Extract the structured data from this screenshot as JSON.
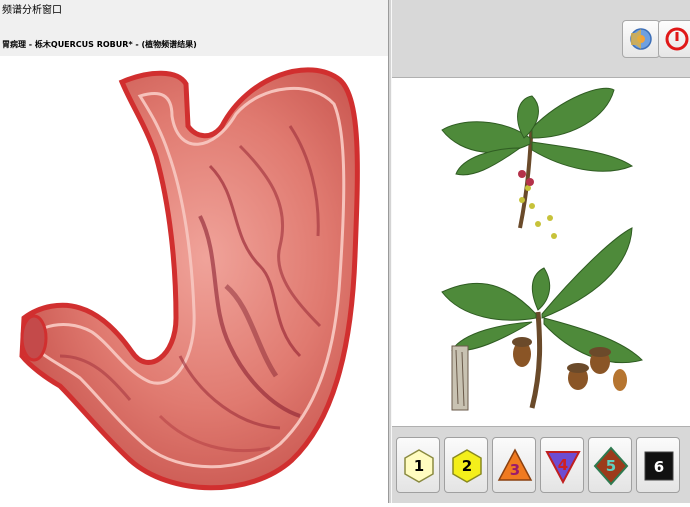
{
  "window": {
    "title": "频谱分析窗口",
    "caption": "胃病理 - 栎木QUERCUS ROBUR* - (植物频谱结果)"
  },
  "toolbar": {
    "buttons": [
      {
        "name": "audio",
        "icon": "speaker-disc-icon"
      },
      {
        "name": "stop",
        "icon": "power-stop-icon"
      }
    ]
  },
  "levels": [
    {
      "label": "1",
      "shape": "hexagon",
      "fill": "#fffcc0"
    },
    {
      "label": "2",
      "shape": "hexagon",
      "fill": "#f4ef1b"
    },
    {
      "label": "3",
      "shape": "triangle-up",
      "fill": "#f07a20"
    },
    {
      "label": "4",
      "shape": "triangle-down",
      "fill": "#6e4cd1"
    },
    {
      "label": "5",
      "shape": "diamond",
      "fill": "#9c3a1a"
    },
    {
      "label": "6",
      "shape": "square",
      "fill": "#111111"
    }
  ],
  "colors": {
    "stomach_outer": "#d64444",
    "stomach_fill": "#e47b73",
    "leaf": "#4e8a3a",
    "stop_red": "#e01818"
  }
}
